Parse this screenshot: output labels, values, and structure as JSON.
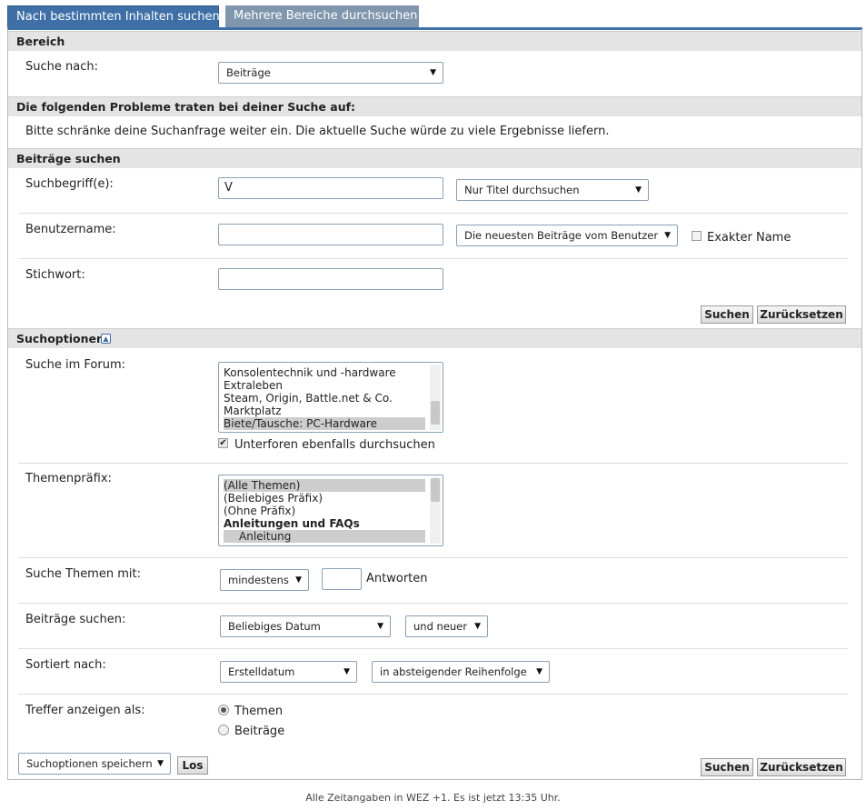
{
  "tabs": [
    {
      "label": "Nach bestimmten Inhalten suchen"
    },
    {
      "label": "Mehrere Bereiche durchsuchen"
    }
  ],
  "bereich": {
    "header": "Bereich",
    "suche_nach_label": "Suche nach:",
    "suche_nach_value": "Beiträge"
  },
  "probleme": {
    "header": "Die folgenden Probleme traten bei deiner Suche auf:",
    "message": "Bitte schränke deine Suchanfrage weiter ein. Die aktuelle Suche würde zu viele Ergebnisse liefern."
  },
  "beitraege_suchen": {
    "header": "Beiträge suchen",
    "suchbegriff_label": "Suchbegriff(e):",
    "suchbegriff_value": "V",
    "suchbegriff_scope": "Nur Titel durchsuchen",
    "benutzername_label": "Benutzername:",
    "benutzername_value": "",
    "benutzer_mode": "Die neuesten Beiträge vom Benutzer",
    "exakter_name_label": "Exakter Name",
    "stichwort_label": "Stichwort:",
    "stichwort_value": "",
    "search_button": "Suchen",
    "reset_button": "Zurücksetzen"
  },
  "suchoptionen": {
    "header": "Suchoptionen",
    "forum_label": "Suche im Forum:",
    "forum_options": [
      "Konsolentechnik und -hardware",
      "Extraleben",
      "Steam, Origin, Battle.net & Co.",
      "Marktplatz",
      "Biete/Tausche: PC-Hardware"
    ],
    "unterforen_label": "Unterforen ebenfalls durchsuchen",
    "praefix_label": "Themenpräfix:",
    "praefix_options": [
      "(Alle Themen)",
      "(Beliebiges Präfix)",
      "(Ohne Präfix)",
      "Anleitungen und FAQs",
      "Anleitung"
    ],
    "themen_mit_label": "Suche Themen mit:",
    "themen_mit_value": "mindestens",
    "antworten_value": "",
    "antworten_label": "Antworten",
    "beitraege_label": "Beiträge suchen:",
    "datum_value": "Beliebiges Datum",
    "datum_mode": "und neuer",
    "sortiert_label": "Sortiert nach:",
    "sort_value": "Erstelldatum",
    "sort_order": "in absteigender Reihenfolge",
    "treffer_label": "Treffer anzeigen als:",
    "treffer_themen": "Themen",
    "treffer_beitraege": "Beiträge",
    "save_options": "Suchoptionen speichern",
    "los_button": "Los",
    "search_button": "Suchen",
    "reset_button": "Zurücksetzen"
  },
  "footer": "Alle Zeitangaben in WEZ +1. Es ist jetzt 13:35 Uhr."
}
